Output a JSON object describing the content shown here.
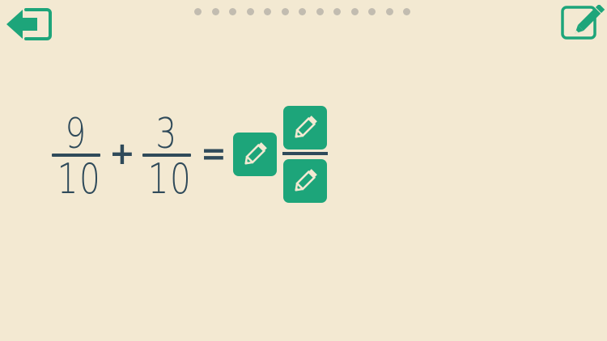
{
  "header": {
    "back_icon": "back-arrow-exit-icon",
    "edit_icon": "pencil-edit-icon",
    "progress_dot_count": 13
  },
  "equation": {
    "fraction_1": {
      "numerator": "9",
      "denominator": "10"
    },
    "operator": "+",
    "fraction_2": {
      "numerator": "3",
      "denominator": "10"
    },
    "equals": "=",
    "answer_whole_icon": "pencil-icon",
    "answer_numerator_icon": "pencil-icon",
    "answer_denominator_icon": "pencil-icon"
  },
  "colors": {
    "background": "#f3e9d2",
    "accent_green": "#1da57a",
    "text_dark": "#2f4a5a",
    "dot_gray": "#c2bcb0"
  }
}
